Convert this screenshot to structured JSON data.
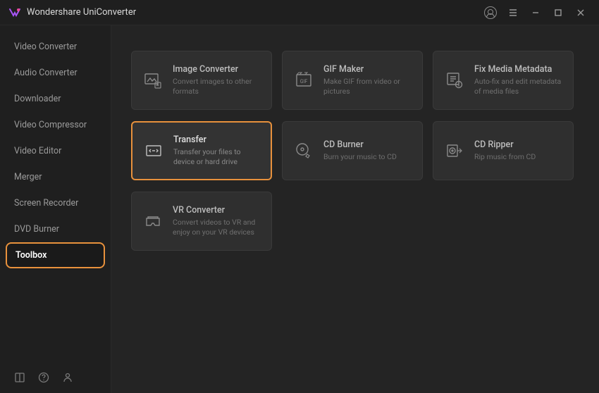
{
  "titlebar": {
    "app_title": "Wondershare UniConverter"
  },
  "sidebar": {
    "items": [
      {
        "label": "Video Converter",
        "active": false
      },
      {
        "label": "Audio Converter",
        "active": false
      },
      {
        "label": "Downloader",
        "active": false
      },
      {
        "label": "Video Compressor",
        "active": false
      },
      {
        "label": "Video Editor",
        "active": false
      },
      {
        "label": "Merger",
        "active": false
      },
      {
        "label": "Screen Recorder",
        "active": false
      },
      {
        "label": "DVD Burner",
        "active": false
      },
      {
        "label": "Toolbox",
        "active": true
      }
    ]
  },
  "tools": [
    {
      "icon": "image-convert-icon",
      "title": "Image Converter",
      "desc": "Convert images to other formats",
      "highlighted": false
    },
    {
      "icon": "gif-icon",
      "title": "GIF Maker",
      "desc": "Make GIF from video or pictures",
      "highlighted": false
    },
    {
      "icon": "metadata-icon",
      "title": "Fix Media Metadata",
      "desc": "Auto-fix and edit metadata of media files",
      "highlighted": false
    },
    {
      "icon": "transfer-icon",
      "title": "Transfer",
      "desc": "Transfer your files to device or hard drive",
      "highlighted": true
    },
    {
      "icon": "cd-burn-icon",
      "title": "CD Burner",
      "desc": "Burn your music to CD",
      "highlighted": false
    },
    {
      "icon": "cd-rip-icon",
      "title": "CD Ripper",
      "desc": "Rip music from CD",
      "highlighted": false
    },
    {
      "icon": "vr-icon",
      "title": "VR Converter",
      "desc": "Convert videos to VR and enjoy on your VR devices",
      "highlighted": false
    }
  ]
}
